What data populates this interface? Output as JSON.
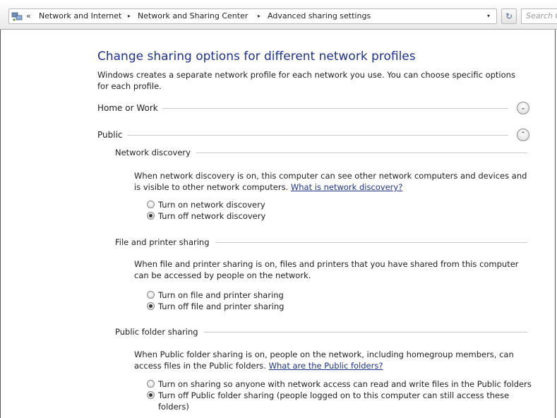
{
  "address_bar": {
    "back_chevron": "«",
    "crumbs": [
      "Network and Internet",
      "Network and Sharing Center",
      "Advanced sharing settings"
    ],
    "separator": "▸",
    "dropdown_glyph": "▾",
    "refresh_glyph": "↻",
    "search_placeholder": "Search Cont"
  },
  "page": {
    "title": "Change sharing options for different network profiles",
    "intro": "Windows creates a separate network profile for each network you use. You can choose specific options for each profile."
  },
  "profiles": {
    "home_work": {
      "label": "Home or Work",
      "toggle_glyph": "⌄",
      "expanded": false
    },
    "public": {
      "label": "Public",
      "toggle_glyph": "⌃",
      "expanded": true
    }
  },
  "sections": {
    "network_discovery": {
      "label": "Network discovery",
      "description": "When network discovery is on, this computer can see other network computers and devices and is visible to other network computers.",
      "link": "What is network discovery?",
      "options": [
        {
          "label": "Turn on network discovery",
          "checked": false
        },
        {
          "label": "Turn off network discovery",
          "checked": true
        }
      ]
    },
    "file_printer": {
      "label": "File and printer sharing",
      "description": "When file and printer sharing is on, files and printers that you have shared from this computer can be accessed by people on the network.",
      "options": [
        {
          "label": "Turn on file and printer sharing",
          "checked": false
        },
        {
          "label": "Turn off file and printer sharing",
          "checked": true
        }
      ]
    },
    "public_folder": {
      "label": "Public folder sharing",
      "description": "When Public folder sharing is on, people on the network, including homegroup members, can access files in the Public folders.",
      "link": "What are the Public folders?",
      "options": [
        {
          "label": "Turn on sharing so anyone with network access can read and write files in the Public folders",
          "checked": false
        },
        {
          "label": "Turn off Public folder sharing (people logged on to this computer can still access these folders)",
          "checked": true
        }
      ]
    }
  },
  "icons": {
    "address": "network-icon",
    "refresh": "refresh-icon",
    "expand": "expand-icon",
    "collapse": "collapse-icon"
  }
}
